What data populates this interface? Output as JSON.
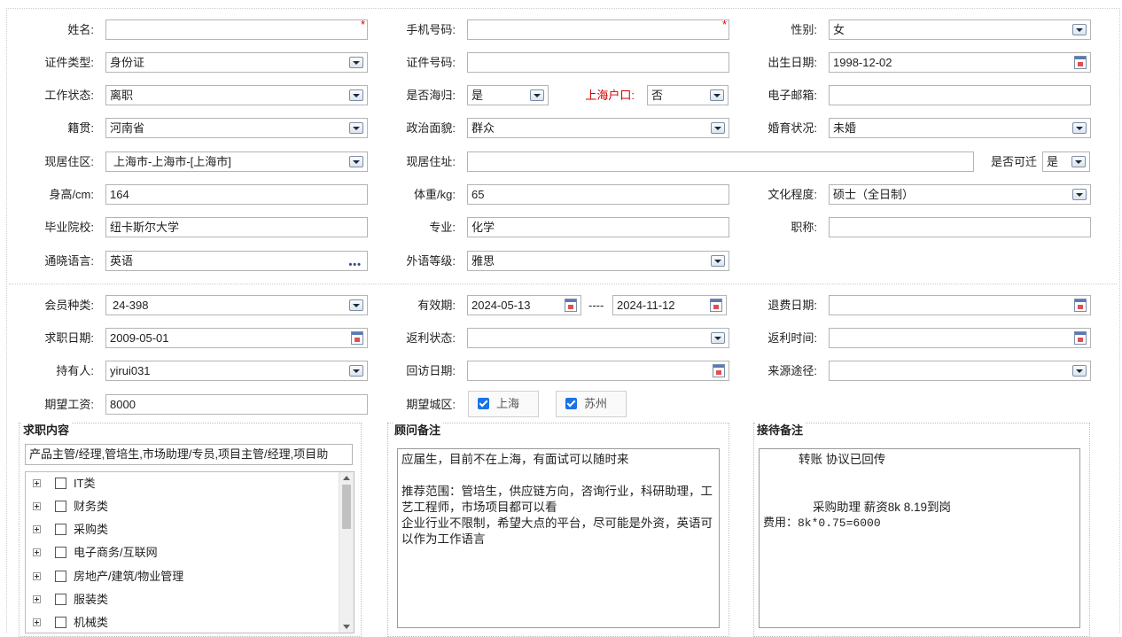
{
  "section_basic": {
    "name_label": "姓名:",
    "name_value": "",
    "phone_label": "手机号码:",
    "phone_value": "",
    "gender_label": "性别:",
    "gender_value": "女",
    "idtype_label": "证件类型:",
    "idtype_value": "身份证",
    "idno_label": "证件号码:",
    "idno_value": "",
    "birth_label": "出生日期:",
    "birth_value": "1998-12-02",
    "workstatus_label": "工作状态:",
    "workstatus_value": "离职",
    "returnee_label": "是否海归:",
    "returnee_value": "是",
    "hukou_label": "上海户口:",
    "hukou_value": "否",
    "email_label": "电子邮箱:",
    "email_value": "",
    "native_label": "籍贯:",
    "native_value": "河南省",
    "political_label": "政治面貌:",
    "political_value": "群众",
    "marital_label": "婚育状况:",
    "marital_value": "未婚",
    "region_label": "现居住区:",
    "region_value": "上海市-上海市-[上海市]",
    "address_label": "现居住址:",
    "address_value": "",
    "relocate_label": "是否可迁",
    "relocate_value": "是",
    "height_label": "身高/cm:",
    "height_value": "164",
    "weight_label": "体重/kg:",
    "weight_value": "65",
    "education_label": "文化程度:",
    "education_value": "硕士（全日制）",
    "school_label": "毕业院校:",
    "school_value": "纽卡斯尔大学",
    "major_label": "专业:",
    "major_value": "化学",
    "title_label": "职称:",
    "title_value": "",
    "language_label": "通晓语言:",
    "language_value": "英语",
    "langlevel_label": "外语等级:",
    "langlevel_value": "雅思"
  },
  "section_member": {
    "membertype_label": "会员种类:",
    "membertype_value": "24-398",
    "validity_label": "有效期:",
    "validity_start": "2024-05-13",
    "validity_sep": "----",
    "validity_end": "2024-11-12",
    "refund_label": "退费日期:",
    "refund_value": "",
    "jobdate_label": "求职日期:",
    "jobdate_value": "2009-05-01",
    "rebate_status_label": "返利状态:",
    "rebate_status_value": "",
    "rebate_time_label": "返利时间:",
    "rebate_time_value": "",
    "holder_label": "持有人:",
    "holder_value": "yirui031",
    "revisit_label": "回访日期:",
    "revisit_value": "",
    "source_label": "来源途径:",
    "source_value": "",
    "salary_label": "期望工资:",
    "salary_value": "8000",
    "city_label": "期望城区:",
    "cities": [
      "上海",
      "苏州"
    ]
  },
  "job_content": {
    "legend": "求职内容",
    "selected_text": "产品主管/经理,管培生,市场助理/专员,项目主管/经理,项目助",
    "categories": [
      "IT类",
      "财务类",
      "采购类",
      "电子商务/互联网",
      "房地产/建筑/物业管理",
      "服装类",
      "机械类"
    ]
  },
  "advisor_note": {
    "legend": "顾问备注",
    "text": "应届生，目前不在上海，有面试可以随时来\n\n推荐范围：管培生，供应链方向，咨询行业，科研助理，工艺工程师，市场项目都可以看\n企业行业不限制，希望大点的平台，尽可能是外资，英语可以作为工作语言"
  },
  "reception_note": {
    "legend": "接待备注",
    "line1": "转账  协议已回传",
    "line2": "采购助理 薪资8k 8.19到岗",
    "line3": "费用：8k*0.75=6000"
  },
  "required_mark": "*",
  "more_dots": "•••"
}
